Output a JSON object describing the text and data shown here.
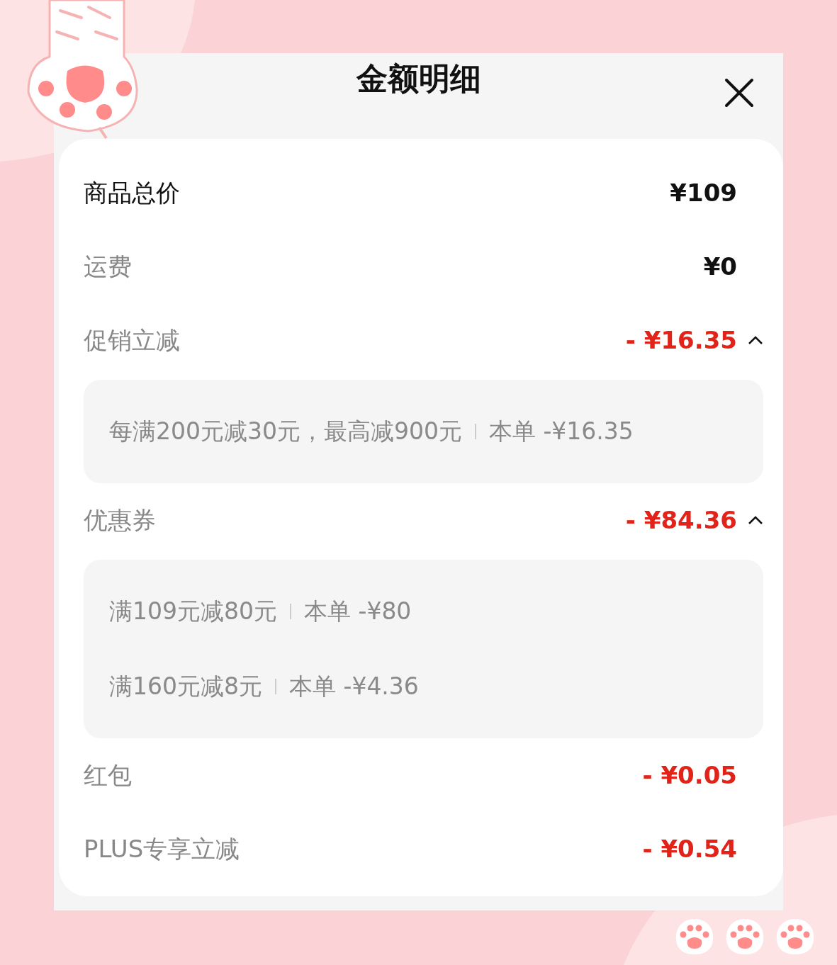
{
  "title": "金额明细",
  "rows": [
    {
      "label": "商品总价",
      "value": "¥109",
      "kind": "total"
    },
    {
      "label": "运费",
      "value": "¥0",
      "kind": "plain"
    },
    {
      "label": "促销立减",
      "value": "- ¥16.35",
      "kind": "discount",
      "expanded": true,
      "details": [
        {
          "rule": "每满200元减30元，最高减900元",
          "amount": "本单 -¥16.35"
        }
      ]
    },
    {
      "label": "优惠券",
      "value": "- ¥84.36",
      "kind": "discount",
      "expanded": true,
      "details": [
        {
          "rule": "满109元减80元",
          "amount": "本单 -¥80"
        },
        {
          "rule": "满160元减8元",
          "amount": "本单 -¥4.36"
        }
      ]
    },
    {
      "label": "红包",
      "value": "- ¥0.05",
      "kind": "discount"
    },
    {
      "label": "PLUS专享立减",
      "value": "- ¥0.54",
      "kind": "discount"
    }
  ]
}
